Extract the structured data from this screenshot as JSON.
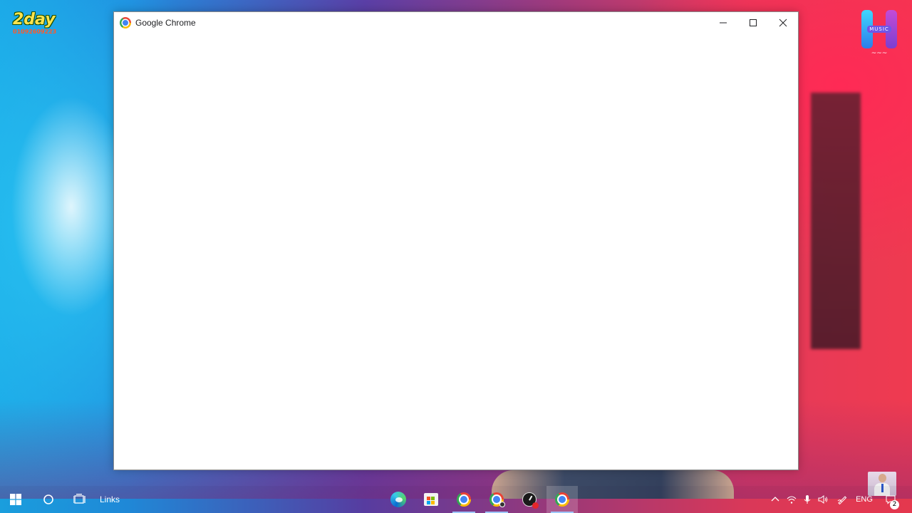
{
  "window": {
    "title": "Google Chrome",
    "icon": "chrome-icon",
    "controls": {
      "minimize": "minimize-icon",
      "maximize": "maximize-icon",
      "close": "close-icon"
    }
  },
  "taskbar": {
    "links_label": "Links",
    "apps": [
      "edge-icon",
      "store-icon",
      "chrome-icon",
      "chrome-profile-icon",
      "clock-record-icon",
      "chrome-icon"
    ],
    "tray": {
      "language": "ENG",
      "notification_count": "2"
    }
  },
  "overlay_logos": {
    "left": {
      "brand": "2day",
      "phone": "01092609223"
    },
    "right": {
      "brand": "MUSIC"
    }
  },
  "colors": {
    "window_bg": "#ffffff",
    "accent": "#9ec7ff"
  }
}
